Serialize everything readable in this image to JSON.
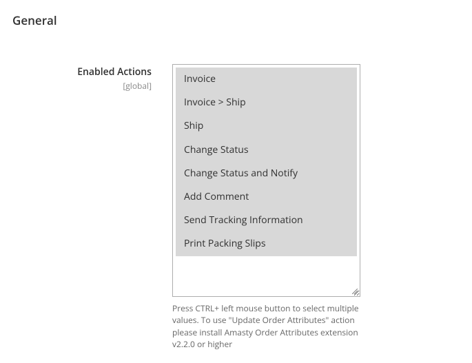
{
  "section": {
    "title": "General"
  },
  "field": {
    "label": "Enabled Actions",
    "scope": "[global]",
    "options": [
      {
        "label": "Invoice",
        "selected": true
      },
      {
        "label": "Invoice > Ship",
        "selected": true
      },
      {
        "label": "Ship",
        "selected": true
      },
      {
        "label": "Change Status",
        "selected": true
      },
      {
        "label": "Change Status and Notify",
        "selected": true
      },
      {
        "label": "Add Comment",
        "selected": true
      },
      {
        "label": "Send Tracking Information",
        "selected": true
      },
      {
        "label": "Print Packing Slips",
        "selected": true
      }
    ],
    "help": "Press CTRL+ left mouse button to select multiple values. To use \"Update Order Attributes\" action please install Amasty Order Attributes extension v2.2.0 or higher"
  }
}
